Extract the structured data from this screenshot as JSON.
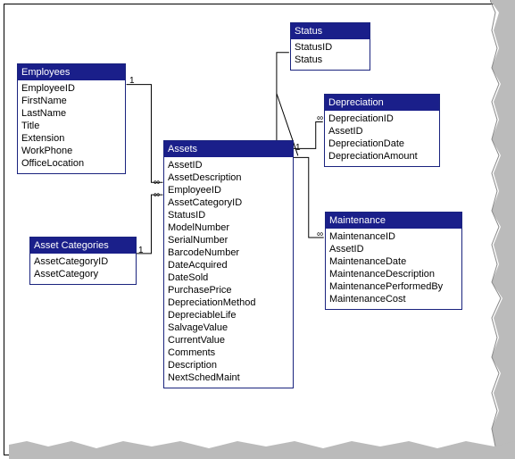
{
  "tables": {
    "employees": {
      "title": "Employees",
      "fields": [
        "EmployeeID",
        "FirstName",
        "LastName",
        "Title",
        "Extension",
        "WorkPhone",
        "OfficeLocation"
      ]
    },
    "assetCategories": {
      "title": "Asset Categories",
      "fields": [
        "AssetCategoryID",
        "AssetCategory"
      ]
    },
    "status": {
      "title": "Status",
      "fields": [
        "StatusID",
        "Status"
      ]
    },
    "assets": {
      "title": "Assets",
      "fields": [
        "AssetID",
        "AssetDescription",
        "EmployeeID",
        "AssetCategoryID",
        "StatusID",
        "ModelNumber",
        "SerialNumber",
        "BarcodeNumber",
        "DateAcquired",
        "DateSold",
        "PurchasePrice",
        "DepreciationMethod",
        "DepreciableLife",
        "SalvageValue",
        "CurrentValue",
        "Comments",
        "Description",
        "NextSchedMaint"
      ]
    },
    "depreciation": {
      "title": "Depreciation",
      "fields": [
        "DepreciationID",
        "AssetID",
        "DepreciationDate",
        "DepreciationAmount"
      ]
    },
    "maintenance": {
      "title": "Maintenance",
      "fields": [
        "MaintenanceID",
        "AssetID",
        "MaintenanceDate",
        "MaintenanceDescription",
        "MaintenancePerformedBy",
        "MaintenanceCost"
      ]
    }
  },
  "relationships": {
    "labels": {
      "one": "1",
      "many": "∞"
    }
  }
}
